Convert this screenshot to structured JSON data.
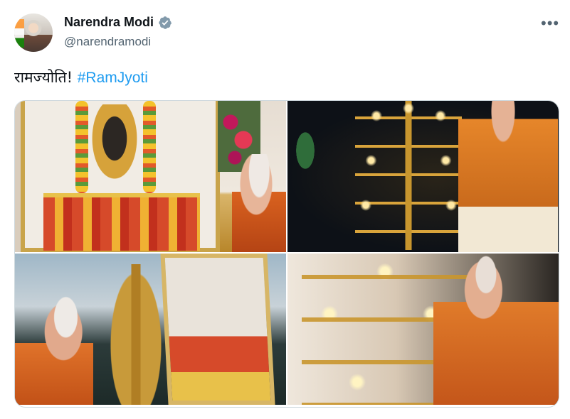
{
  "author": {
    "display_name": "Narendra Modi",
    "handle": "@narendramodi",
    "verified": true,
    "verified_color": "#829aab"
  },
  "tweet": {
    "text": "रामज्योति! ",
    "hashtag": "#RamJyoti",
    "hashtag_color": "#1d9bf0"
  },
  "actions": {
    "more_label": "•••"
  },
  "media": [
    {
      "icon": "photo-shrine"
    },
    {
      "icon": "photo-lamp-night"
    },
    {
      "icon": "photo-lamp-frame"
    },
    {
      "icon": "photo-lamp-closeup"
    }
  ]
}
